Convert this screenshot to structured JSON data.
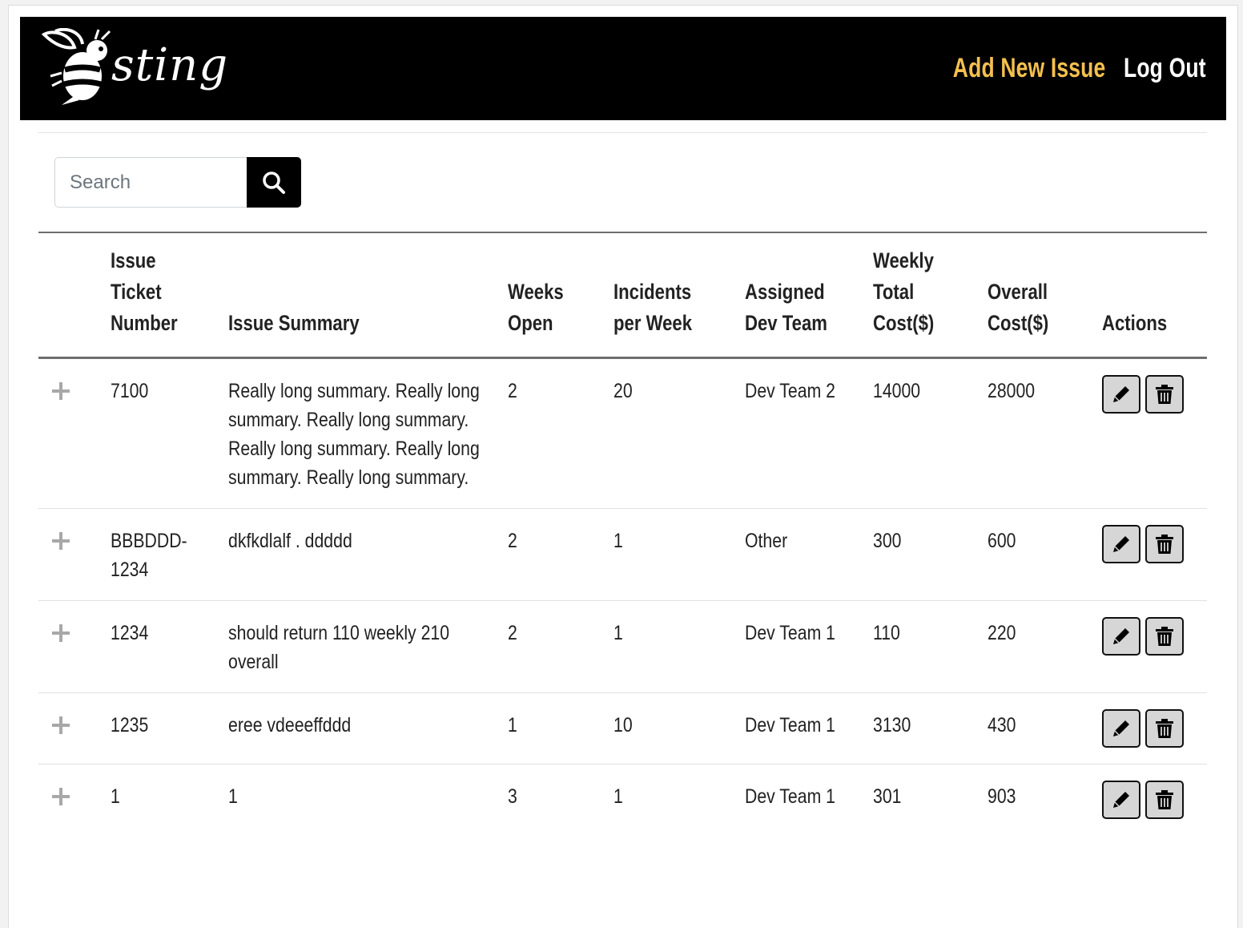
{
  "header": {
    "logo_text": "sting",
    "add_issue_label": "Add New Issue",
    "logout_label": "Log Out",
    "accent_color": "#f4c04e",
    "background_color": "#000000"
  },
  "search": {
    "placeholder": "Search",
    "value": "",
    "button_icon": "search-icon"
  },
  "table": {
    "columns": [
      "",
      "Issue Ticket Number",
      "Issue Summary",
      "Weeks Open",
      "Incidents per Week",
      "Assigned Dev Team",
      "Weekly Total Cost($)",
      "Overall Cost($)",
      "Actions"
    ],
    "rows": [
      {
        "ticket": "7100",
        "summary": "Really long summary. Really long summary. Really long summary. Really long summary. Really long summary. Really long summary.",
        "weeks_open": "2",
        "incidents_per_week": "20",
        "team": "Dev Team 2",
        "weekly_cost": "14000",
        "overall_cost": "28000"
      },
      {
        "ticket": "BBBDDD-1234",
        "summary": "dkfkdlalf . ddddd",
        "weeks_open": "2",
        "incidents_per_week": "1",
        "team": "Other",
        "weekly_cost": "300",
        "overall_cost": "600"
      },
      {
        "ticket": "1234",
        "summary": "should return 110 weekly 210 overall",
        "weeks_open": "2",
        "incidents_per_week": "1",
        "team": "Dev Team 1",
        "weekly_cost": "110",
        "overall_cost": "220"
      },
      {
        "ticket": "1235",
        "summary": "eree vdeeeffddd",
        "weeks_open": "1",
        "incidents_per_week": "10",
        "team": "Dev Team 1",
        "weekly_cost": "3130",
        "overall_cost": "430"
      },
      {
        "ticket": "1",
        "summary": "1",
        "weeks_open": "3",
        "incidents_per_week": "1",
        "team": "Dev Team 1",
        "weekly_cost": "301",
        "overall_cost": "903"
      }
    ],
    "row_actions": [
      "pencil-icon",
      "trash-icon"
    ]
  }
}
